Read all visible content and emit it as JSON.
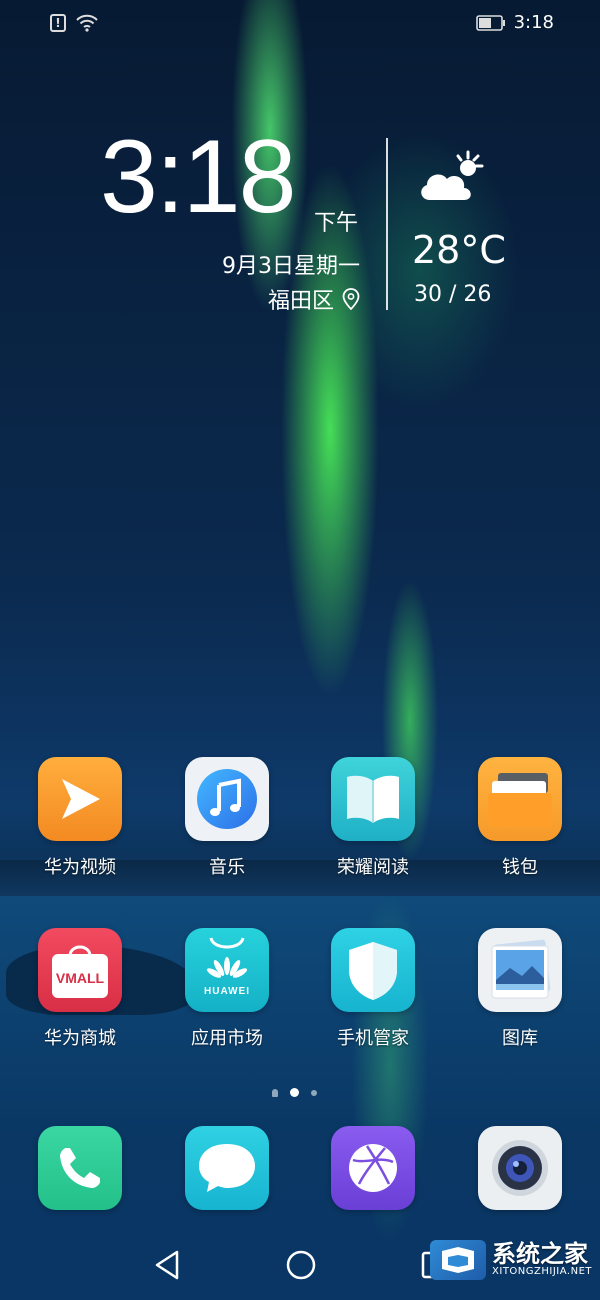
{
  "status_bar": {
    "time": "3:18"
  },
  "clock_widget": {
    "time": "3:18",
    "ampm": "下午",
    "date": "9月3日星期一",
    "location": "福田区"
  },
  "weather": {
    "temperature": "28°C",
    "range": "30 / 26",
    "icon": "partly-cloudy-icon"
  },
  "apps": [
    {
      "label": "华为视频",
      "icon": "huawei-video-icon",
      "color": "#f79a2e"
    },
    {
      "label": "音乐",
      "icon": "music-icon",
      "color": "#e8eef4"
    },
    {
      "label": "荣耀阅读",
      "icon": "reader-book-icon",
      "color": "#2cc3cf"
    },
    {
      "label": "钱包",
      "icon": "wallet-icon",
      "color": "#f7a531"
    },
    {
      "label": "华为商城",
      "icon": "vmall-icon",
      "color": "#e23b4f",
      "badge_text": "VMALL"
    },
    {
      "label": "应用市场",
      "icon": "app-gallery-icon",
      "color": "#1ec2d0",
      "badge_text": "HUAWEI"
    },
    {
      "label": "手机管家",
      "icon": "phone-manager-shield-icon",
      "color": "#22bfd8"
    },
    {
      "label": "图库",
      "icon": "gallery-icon",
      "color": "#eef1f4"
    }
  ],
  "dock": [
    {
      "icon": "phone-icon",
      "color": "#34cf98"
    },
    {
      "icon": "messages-icon",
      "color": "#22bfd8"
    },
    {
      "icon": "browser-icon",
      "color": "#7b4fe0"
    },
    {
      "icon": "camera-icon",
      "color": "#eceff2"
    }
  ],
  "page_indicator": {
    "pages": 3,
    "active": 1
  },
  "watermark": {
    "title": "系统之家",
    "url": "XITONGZHIJIA.NET"
  }
}
